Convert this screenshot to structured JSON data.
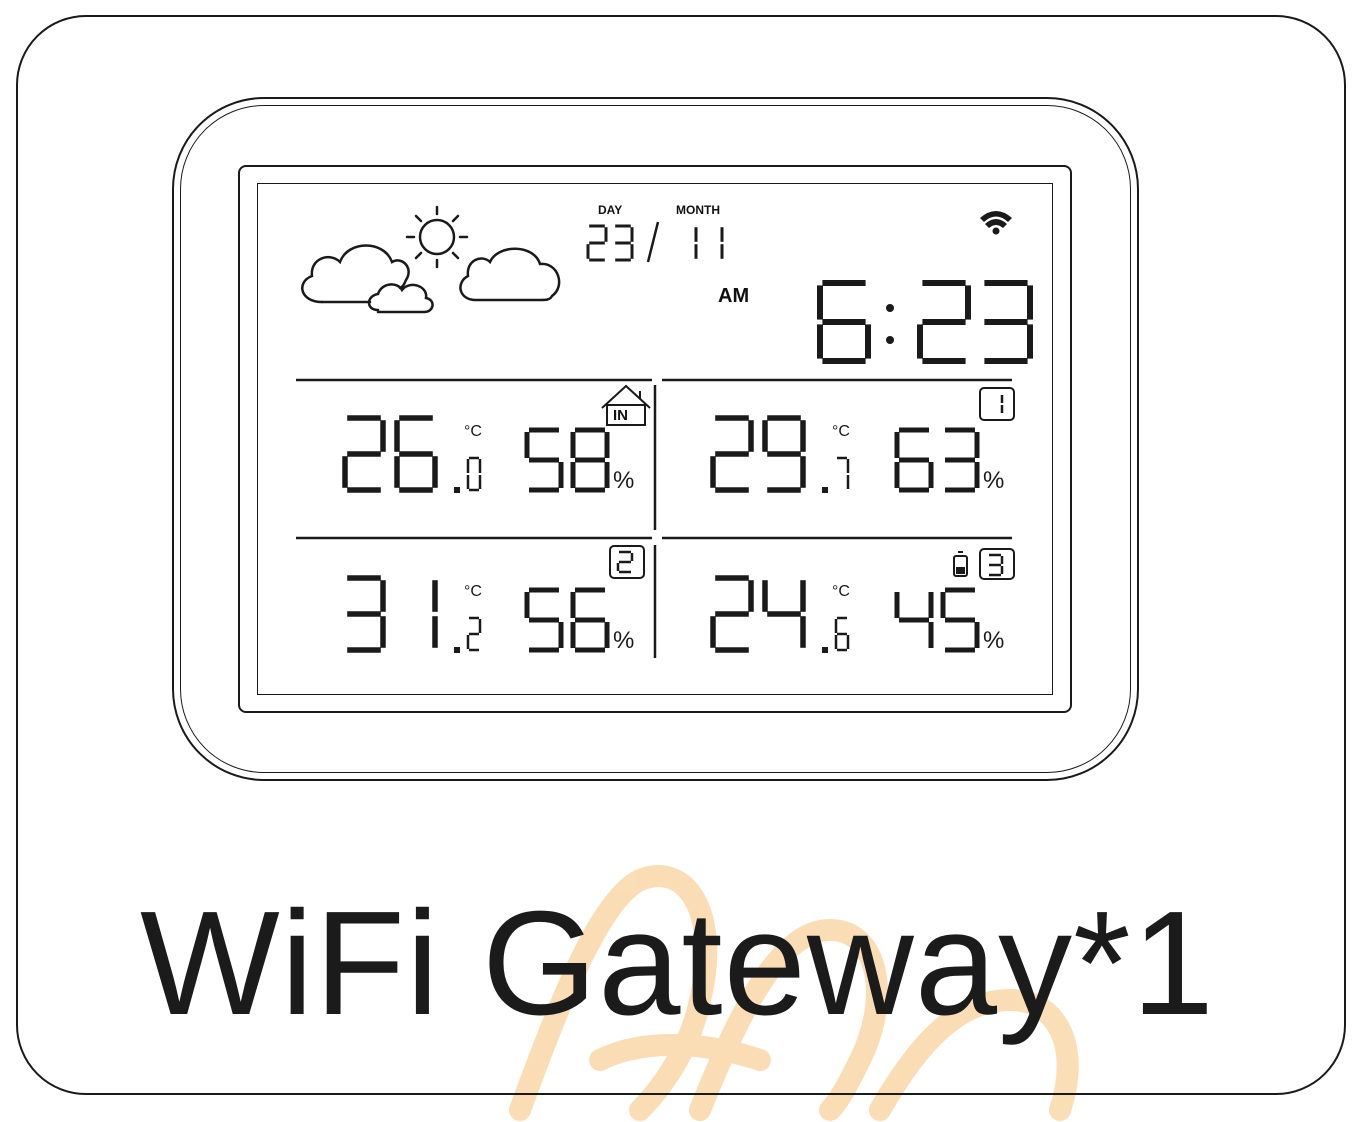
{
  "caption": "WiFi Gateway*1",
  "colors": {
    "line": "#1a1a1a",
    "watermark": "#f6c27a"
  },
  "display": {
    "weather_icon": "partly-sunny-cloudy-icon",
    "wifi_icon": "wifi-icon",
    "date": {
      "day_label": "DAY",
      "month_label": "MONTH",
      "day": "23",
      "month": "11"
    },
    "time": {
      "period": "AM",
      "hour": "6",
      "minute": "23"
    },
    "zones": [
      {
        "id": "indoor",
        "badge": "IN",
        "badge_icon": "house-icon",
        "temp_int": "26",
        "temp_dec": "0",
        "temp_unit": "°C",
        "humidity": "58",
        "humidity_unit": "%"
      },
      {
        "id": "channel-1",
        "badge": "1",
        "temp_int": "29",
        "temp_dec": "7",
        "temp_unit": "°C",
        "humidity": "63",
        "humidity_unit": "%"
      },
      {
        "id": "channel-2",
        "badge": "2",
        "temp_int": "31",
        "temp_dec": "2",
        "temp_unit": "°C",
        "humidity": "56",
        "humidity_unit": "%"
      },
      {
        "id": "channel-3",
        "badge": "3",
        "battery_icon": "battery-low-icon",
        "temp_int": "24",
        "temp_dec": "6",
        "temp_unit": "°C",
        "humidity": "45",
        "humidity_unit": "%"
      }
    ]
  }
}
